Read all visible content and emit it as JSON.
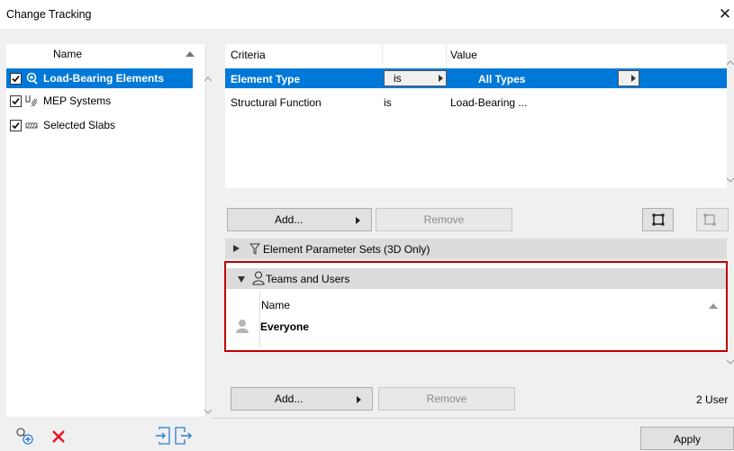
{
  "window": {
    "title": "Change Tracking",
    "close_glyph": "✕"
  },
  "left_panel": {
    "column_header": "Name",
    "items": [
      {
        "label": "Load-Bearing Elements",
        "checked": true,
        "icon": "load-bearing-icon",
        "selected": true
      },
      {
        "label": "MEP Systems",
        "checked": true,
        "icon": "mep-icon",
        "selected": false
      },
      {
        "label": "Selected Slabs",
        "checked": true,
        "icon": "slab-icon",
        "selected": false
      }
    ]
  },
  "criteria": {
    "headers": {
      "criteria": "Criteria",
      "value": "Value"
    },
    "rows": [
      {
        "criteria": "Element Type",
        "operator": "is",
        "value": "All Types",
        "selected": true
      },
      {
        "criteria": "Structural Function",
        "operator": "is",
        "value": "Load-Bearing ...",
        "selected": false
      }
    ],
    "add_label": "Add...",
    "remove_label": "Remove"
  },
  "sections": {
    "parameter_sets": "Element Parameter Sets (3D Only)",
    "teams_users": "Teams and Users"
  },
  "teams": {
    "column_header": "Name",
    "rows": [
      {
        "name": "Everyone"
      }
    ]
  },
  "users_panel": {
    "add_label": "Add...",
    "remove_label": "Remove",
    "count_text": "2 User"
  },
  "footer": {
    "apply_label": "Apply"
  },
  "colors": {
    "selection": "#0078d7",
    "highlight_border": "#c00000",
    "delete": "#e81123"
  }
}
